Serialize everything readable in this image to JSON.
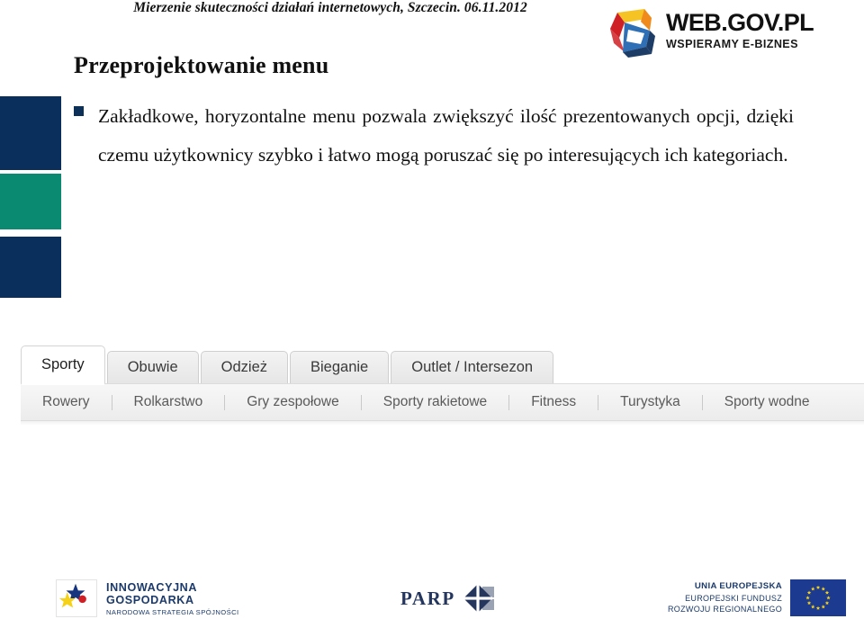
{
  "header": {
    "title": "Mierzenie skuteczności działań internetowych, Szczecin. 06.11.2012"
  },
  "brand": {
    "name": "WEB.GOV.PL",
    "tagline": "WSPIERAMY E-BIZNES",
    "mark_icon": "web-gov-e-logo-icon",
    "colors": {
      "red": "#cf2026",
      "yellow": "#f6c324",
      "orange": "#f08a1d",
      "blue_light": "#2f6fb5",
      "blue_dark": "#1d3c66"
    }
  },
  "decor": {
    "blocks": [
      {
        "name": "navy-top",
        "color": "#0b2f5c"
      },
      {
        "name": "teal-middle",
        "color": "#0b8a72"
      },
      {
        "name": "navy-bottom",
        "color": "#0b2f5c"
      }
    ]
  },
  "slide": {
    "title": "Przeprojektowanie menu",
    "bullet_color": "#0d3058",
    "body": "Zakładkowe, horyzontalne menu pozwala zwiększyć ilość prezentowanych opcji, dzięki czemu użytkownicy szybko i łatwo mogą poruszać się po interesujących ich kategoriach."
  },
  "tabs_widget": {
    "tabs": [
      {
        "label": "Sporty",
        "active": true
      },
      {
        "label": "Obuwie",
        "active": false
      },
      {
        "label": "Odzież",
        "active": false
      },
      {
        "label": "Bieganie",
        "active": false
      },
      {
        "label": "Outlet / Intersezon",
        "active": false
      }
    ],
    "subnav": [
      "Rowery",
      "Rolkarstwo",
      "Gry zespołowe",
      "Sporty rakietowe",
      "Fitness",
      "Turystyka",
      "Sporty wodne"
    ]
  },
  "footer": {
    "innowacyjna": {
      "line1": "INNOWACYJNA",
      "line2": "GOSPODARKA",
      "line3": "NARODOWA STRATEGIA SPÓJNOŚCI",
      "mark_icon": "innowacyjna-gospodarka-stars-icon"
    },
    "parp": {
      "label": "PARP",
      "mark_icon": "parp-diamond-icon"
    },
    "eu": {
      "line1": "UNIA EUROPEJSKA",
      "line2": "EUROPEJSKI FUNDUSZ",
      "line3": "ROZWOJU REGIONALNEGO",
      "flag_icon": "eu-flag-icon",
      "flag_colors": {
        "field": "#1c3a8f",
        "stars": "#f5d117"
      }
    }
  }
}
